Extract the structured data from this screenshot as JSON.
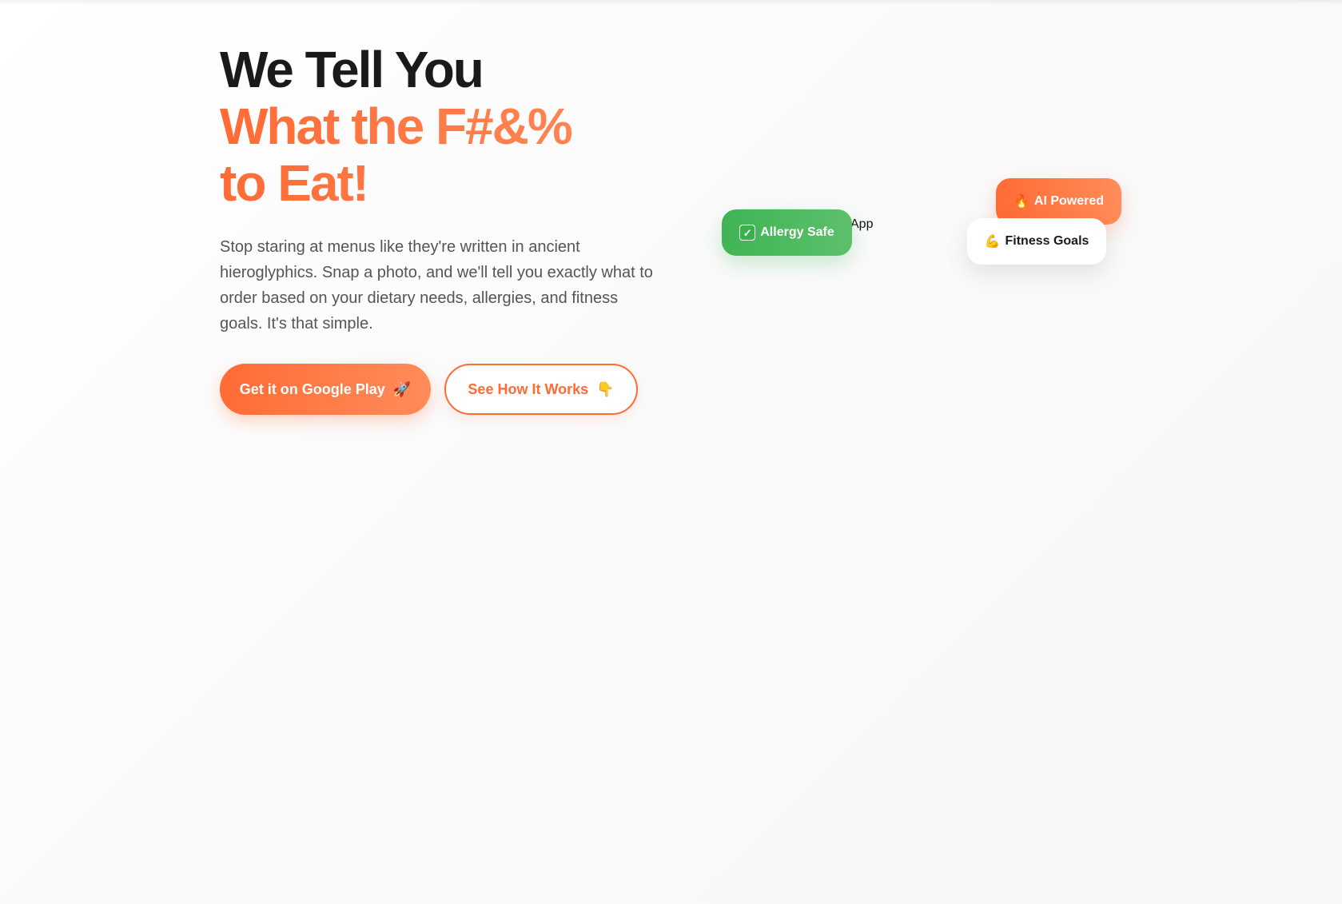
{
  "hero": {
    "headline_line1": "We Tell You",
    "headline_line2": "What the F#&%",
    "headline_line3": "to Eat!",
    "subtitle": "Stop staring at menus like they're written in ancient hieroglyphics. Snap a photo, and we'll tell you exactly what to order based on your dietary needs, allergies, and fitness goals. It's that simple.",
    "primary_cta": {
      "label": "Get it on Google Play",
      "icon": "rocket-icon",
      "glyph": "🚀"
    },
    "secondary_cta": {
      "label": "See How It Works",
      "icon": "pointing-down-icon",
      "glyph": "👇"
    }
  },
  "visual": {
    "app_image_alt": "App",
    "badges": {
      "ai": {
        "label": "AI Powered",
        "icon": "fire-icon",
        "glyph": "🔥"
      },
      "allergy": {
        "label": "Allergy Safe",
        "icon": "check-mark-icon",
        "glyph": "✓"
      },
      "fitness": {
        "label": "Fitness Goals",
        "icon": "flexed-biceps-icon",
        "glyph": "💪"
      }
    }
  },
  "colors": {
    "accent": "#ff6b35",
    "accent_light": "#ff8c5a",
    "success": "#3fb455",
    "headline_dark": "#1a1a1a",
    "body_text": "#555555"
  }
}
